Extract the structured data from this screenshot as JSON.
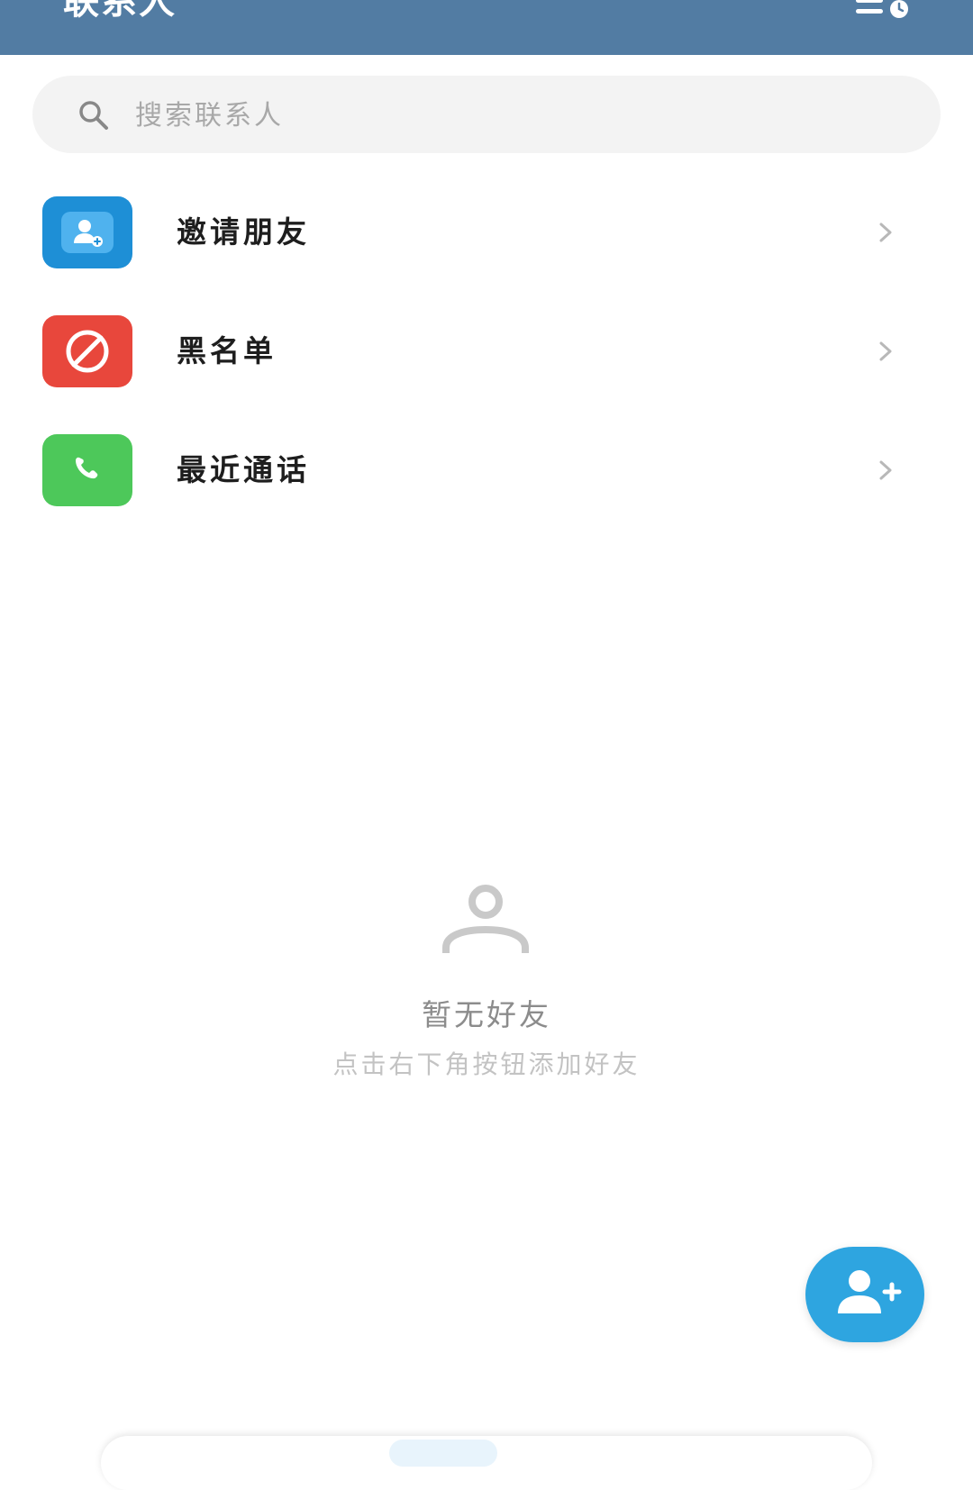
{
  "header": {
    "title": "联系人",
    "menu_icon": "list-clock-icon",
    "background_color": "#527ca3"
  },
  "search": {
    "placeholder": "搜索联系人",
    "value": "",
    "icon": "search-icon"
  },
  "menu": {
    "items": [
      {
        "label": "邀请朋友",
        "icon": "invite-user-icon",
        "color": "#1e8fd6"
      },
      {
        "label": "黑名单",
        "icon": "block-icon",
        "color": "#e8473c"
      },
      {
        "label": "最近通话",
        "icon": "phone-icon",
        "color": "#4dc85a"
      }
    ]
  },
  "empty_state": {
    "icon": "person-outline-icon",
    "title": "暂无好友",
    "hint": "点击右下角按钮添加好友"
  },
  "fab": {
    "icon": "add-user-icon",
    "color": "#2ea5e0"
  }
}
